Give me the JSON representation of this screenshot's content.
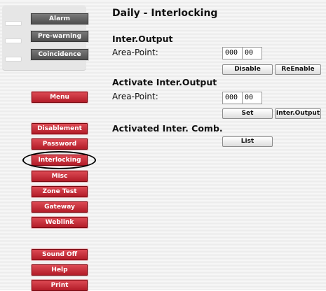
{
  "page": {
    "title": "Daily - Interlocking"
  },
  "status": [
    {
      "id": "alarm",
      "label": "Alarm"
    },
    {
      "id": "pre-warning",
      "label": "Pre-warning"
    },
    {
      "id": "coincidence",
      "label": "Coincidence"
    }
  ],
  "menu": {
    "menu": "Menu",
    "disablement": "Disablement",
    "password": "Password",
    "interlocking": "Interlocking",
    "misc": "Misc",
    "zone_test": "Zone Test",
    "gateway": "Gateway",
    "weblink": "Weblink",
    "sound_off": "Sound Off",
    "help": "Help",
    "print": "Print"
  },
  "inter_output": {
    "heading": "Inter.Output",
    "area_label": "Area-Point:",
    "area": "000",
    "point": "00",
    "disable": "Disable",
    "reenable": "ReEnable"
  },
  "activate": {
    "heading": "Activate Inter.Output",
    "area_label": "Area-Point:",
    "area": "000",
    "point": "00",
    "set": "Set",
    "inter_output": "Inter.Output"
  },
  "activated": {
    "heading": "Activated Inter. Comb.",
    "list": "List"
  }
}
